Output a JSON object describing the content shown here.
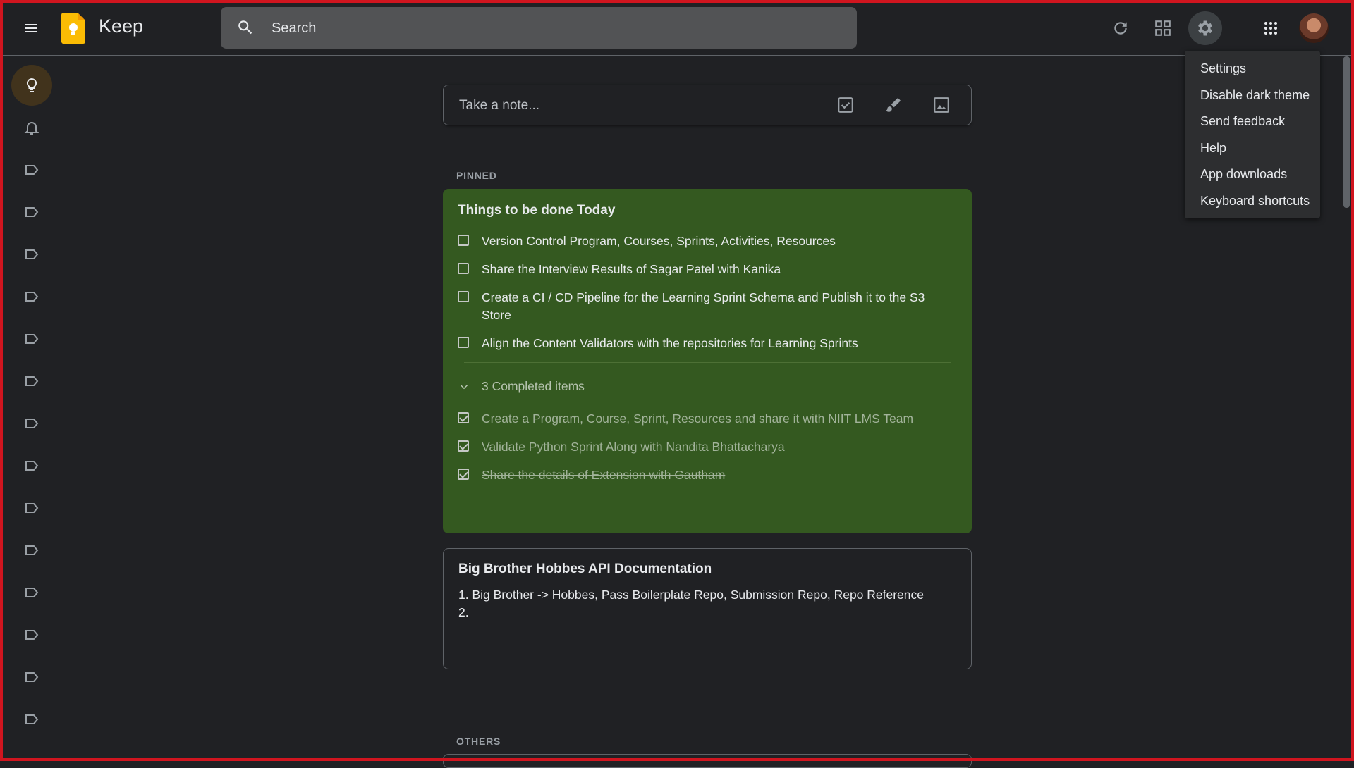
{
  "app": {
    "title": "Keep"
  },
  "search": {
    "placeholder": "Search"
  },
  "take_note": {
    "placeholder": "Take a note..."
  },
  "sections": {
    "pinned": "PINNED",
    "others": "OTHERS"
  },
  "notes": [
    {
      "title": "Things to be done Today",
      "color": "#345920",
      "items": [
        {
          "text": "Version Control Program, Courses, Sprints,  Activities, Resources",
          "checked": false
        },
        {
          "text": "Share the Interview Results of Sagar Patel with Kanika",
          "checked": false
        },
        {
          "text": "Create a CI / CD Pipeline for the Learning Sprint Schema and Publish it to the S3 Store",
          "checked": false
        },
        {
          "text": "Align the Content Validators with the repositories for Learning Sprints",
          "checked": false
        }
      ],
      "completed_label": "3 Completed items",
      "completed": [
        {
          "text": "Create a Program, Course, Sprint, Resources and share it with NIIT LMS Team",
          "checked": true
        },
        {
          "text": "Validate Python Sprint Along with Nandita Bhattacharya",
          "checked": true
        },
        {
          "text": "Share the details of Extension with Gautham",
          "checked": true
        }
      ]
    },
    {
      "title": "Big Brother Hobbes API Documentation",
      "lines": [
        "1. Big Brother -> Hobbes, Pass Boilerplate Repo, Submission Repo, Repo Reference",
        "2."
      ]
    }
  ],
  "settings_menu": {
    "items": [
      "Settings",
      "Disable dark theme",
      "Send feedback",
      "Help",
      "App downloads",
      "Keyboard shortcuts"
    ]
  },
  "sidebar": {
    "items": [
      "lightbulb-icon",
      "bell-icon",
      "label-icon",
      "label-icon",
      "label-icon",
      "label-icon",
      "label-icon",
      "label-icon",
      "label-icon",
      "label-icon",
      "label-icon",
      "label-icon",
      "label-icon",
      "label-icon",
      "label-icon",
      "label-icon"
    ]
  },
  "colors": {
    "accent": "#fbbc04",
    "background": "#202124",
    "pinned_note": "#345920"
  }
}
